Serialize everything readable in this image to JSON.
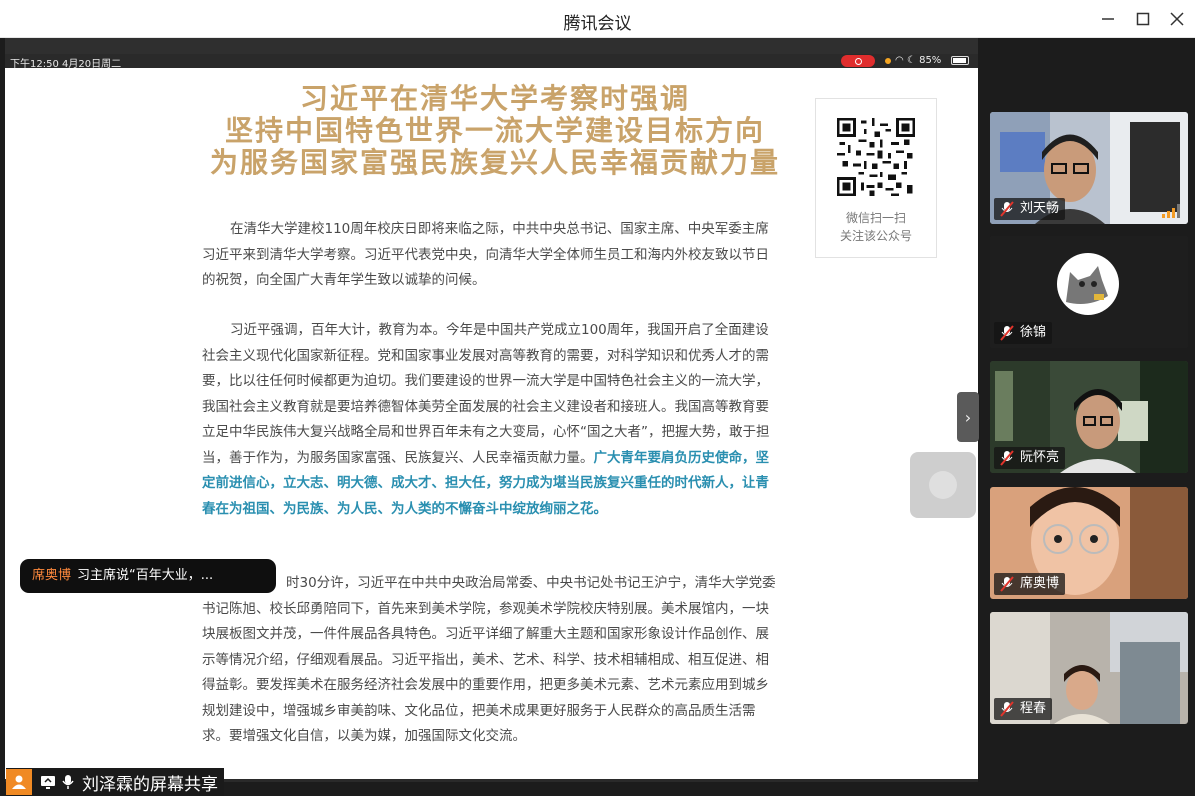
{
  "window": {
    "title": "腾讯会议"
  },
  "phone_status": {
    "time": "下午12:50   4月20日周二",
    "battery": "85%"
  },
  "article": {
    "headline": [
      "习近平在清华大学考察时强调",
      "坚持中国特色世界一流大学建设目标方向",
      "为服务国家富强民族复兴人民幸福贡献力量"
    ],
    "qr_caption_1": "微信扫一扫",
    "qr_caption_2": "关注该公众号",
    "para1": "在清华大学建校110周年校庆日即将来临之际，中共中央总书记、国家主席、中央军委主席习近平来到清华大学考察。习近平代表党中央，向清华大学全体师生员工和海内外校友致以节日的祝贺，向全国广大青年学生致以诚挚的问候。",
    "para2_normal": "习近平强调，百年大计，教育为本。今年是中国共产党成立100周年，我国开启了全面建设社会主义现代化国家新征程。党和国家事业发展对高等教育的需要，对科学知识和优秀人才的需要，比以往任何时候都更为迫切。我们要建设的世界一流大学是中国特色社会主义的一流大学，我国社会主义教育就是要培养德智体美劳全面发展的社会主义建设者和接班人。我国高等教育要立足中华民族伟大复兴战略全局和世界百年未有之大变局，心怀“国之大者”，把握大势，敢于担当，善于作为，为服务国家富强、民族复兴、人民幸福贡献力量。",
    "para2_highlight": "广大青年要肩负历史使命，坚定前进信心，立大志、明大德、成大才、担大任，努力成为堪当民族复兴重任的时代新人，让青春在为祖国、为民族、为人民、为人类的不懈奋斗中绽放绚丽之花。",
    "para3_visible": "时30分许，习近平在中共中央政治局常委、中央书记处书记王沪宁，清华大学党委书记陈旭、校长邱勇陪同下，首先来到美术学院，参观美术学院校庆特别展。美术展馆内，一块块展板图文并茂，一件件展品各具特色。习近平详细了解重大主题和国家形象设计作品创作、展示等情况介绍，仔细观看展品。习近平指出，美术、艺术、科学、技术相辅相成、相互促进、相得益彰。要发挥美术在服务经济社会发展中的重要作用，把更多美术元素、艺术元素应用到城乡规划建设中，增强城乡审美韵味、文化品位，把美术成果更好服务于人民群众的高品质生活需求。要增强文化自信，以美为媒，加强国际文化交流。"
  },
  "caption": {
    "speaker": "席奥博",
    "text": "习主席说“百年大业，..."
  },
  "participants": [
    {
      "name": "刘天畅"
    },
    {
      "name": "徐锦"
    },
    {
      "name": "阮怀亮"
    },
    {
      "name": "席奥博"
    },
    {
      "name": "程春"
    }
  ],
  "share_label": "刘泽霖的屏幕共享",
  "colors": {
    "headline": "#c9a36a",
    "highlight": "#2a8fb0",
    "recording": "#e02d2d",
    "speaker": "#ff8a3d",
    "user_icon": "#f08a24"
  }
}
